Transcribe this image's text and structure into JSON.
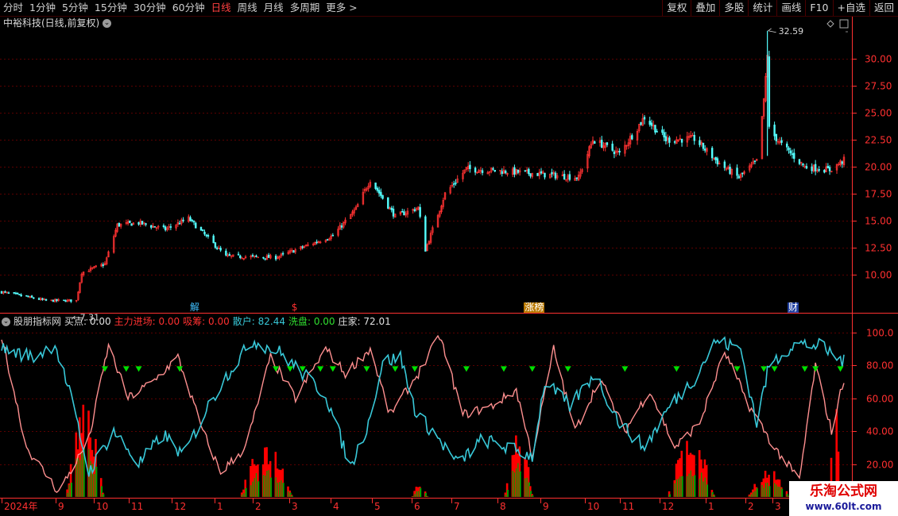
{
  "toolbar": {
    "periods": [
      "分时",
      "1分钟",
      "5分钟",
      "15分钟",
      "30分钟",
      "60分钟",
      "日线",
      "周线",
      "月线",
      "多周期",
      "更多 >"
    ],
    "active_period": "日线",
    "tools": [
      "复权",
      "叠加",
      "多股",
      "统计",
      "画线",
      "F10",
      "+自选",
      "返回"
    ]
  },
  "stock": {
    "title": "中裕科技(日线,前复权)"
  },
  "events": [
    {
      "label": "解",
      "color": "#40c0ff",
      "date": "2024-11-28"
    },
    {
      "label": "$",
      "color": "#ff3030",
      "date": "2025-01-24"
    },
    {
      "label": "涨榜",
      "color": "#ffffff",
      "bg": "#b87800",
      "date": "2025-06-04"
    },
    {
      "label": "财",
      "color": "#ffffff",
      "bg": "#2040a0",
      "date": "2025-10-30"
    }
  ],
  "indicator": {
    "name": "股朋指标网",
    "items": [
      {
        "label": "买点: 0.00",
        "color": "#e0e0e0"
      },
      {
        "label": "主力进场: 0.00",
        "color": "#ff3030"
      },
      {
        "label": "吸筹: 0.00",
        "color": "#ff3030"
      },
      {
        "label": "散户: 82.44",
        "color": "#38c8d8"
      },
      {
        "label": "洗盘: 0.00",
        "color": "#30e030"
      },
      {
        "label": "庄家: 72.01",
        "color": "#e0e0e0"
      }
    ]
  },
  "price_axis_labels": [
    "30.00",
    "27.50",
    "25.00",
    "22.50",
    "20.00",
    "17.50",
    "15.00",
    "12.50",
    "10.00"
  ],
  "indicator_axis_labels": [
    "100.0",
    "80.00",
    "60.00",
    "40.00",
    "20.00"
  ],
  "date_axis_labels": [
    "2024年",
    "9",
    "10",
    "11",
    "12",
    "1",
    "2",
    "3",
    "4",
    "5",
    "6",
    "7",
    "8",
    "9",
    "10",
    "11",
    "12",
    "1",
    "2",
    "3"
  ],
  "watermark": {
    "line1": "乐淘公式网",
    "line2": "www.60lt.com"
  },
  "colors": {
    "up": "#ff3232",
    "down": "#54ffff",
    "grid": "#5a0000",
    "axis": "#ff3030",
    "sanhu": "#38c8d8",
    "zhuangjia": "#ff9090",
    "buy_marker": "#00e000",
    "bars_red": "#ff0000",
    "bars_green": "#00a000"
  },
  "chart_data": {
    "type": "candlestick",
    "date_range": [
      "2024-08-12",
      "2025-11-28"
    ],
    "price_ylim": [
      7.31,
      32.59
    ],
    "price_ticks": [
      10,
      12.5,
      15,
      17.5,
      20,
      22.5,
      25,
      27.5,
      30
    ],
    "max_label": "32.59",
    "min_label": "7.31",
    "price_anchors": [
      {
        "date": "2024-08-12",
        "value": 8.4
      },
      {
        "date": "2024-09-06",
        "value": 7.6
      },
      {
        "date": "2024-09-23",
        "value": 7.6
      },
      {
        "date": "2024-09-26",
        "value": 10.2
      },
      {
        "date": "2024-10-09",
        "value": 11.0
      },
      {
        "date": "2024-10-16",
        "value": 14.6
      },
      {
        "date": "2024-10-28",
        "value": 14.8
      },
      {
        "date": "2024-11-12",
        "value": 14.2
      },
      {
        "date": "2024-11-25",
        "value": 15.2
      },
      {
        "date": "2024-12-16",
        "value": 11.7
      },
      {
        "date": "2025-01-13",
        "value": 11.6
      },
      {
        "date": "2025-02-14",
        "value": 13.6
      },
      {
        "date": "2025-02-27",
        "value": 16.1
      },
      {
        "date": "2025-03-07",
        "value": 18.8
      },
      {
        "date": "2025-03-21",
        "value": 15.4
      },
      {
        "date": "2025-04-03",
        "value": 16.2
      },
      {
        "date": "2025-04-07",
        "value": 12.3
      },
      {
        "date": "2025-04-18",
        "value": 17.5
      },
      {
        "date": "2025-04-30",
        "value": 19.8
      },
      {
        "date": "2025-05-20",
        "value": 19.6
      },
      {
        "date": "2025-06-05",
        "value": 19.4
      },
      {
        "date": "2025-06-18",
        "value": 19.2
      },
      {
        "date": "2025-07-02",
        "value": 19.0
      },
      {
        "date": "2025-07-10",
        "value": 22.5
      },
      {
        "date": "2025-07-25",
        "value": 21.2
      },
      {
        "date": "2025-08-08",
        "value": 24.6
      },
      {
        "date": "2025-08-20",
        "value": 22.5
      },
      {
        "date": "2025-09-05",
        "value": 22.6
      },
      {
        "date": "2025-09-19",
        "value": 20.3
      },
      {
        "date": "2025-09-30",
        "value": 19.0
      },
      {
        "date": "2025-10-10",
        "value": 20.5
      },
      {
        "date": "2025-10-14",
        "value": 26.0
      },
      {
        "date": "2025-10-16",
        "value": 30.5
      },
      {
        "date": "2025-10-17",
        "value": 23.5
      },
      {
        "date": "2025-10-23",
        "value": 22.2
      },
      {
        "date": "2025-11-06",
        "value": 20.0
      },
      {
        "date": "2025-11-20",
        "value": 19.7
      },
      {
        "date": "2025-11-28",
        "value": 20.6
      }
    ],
    "indicator_ylim": [
      0,
      110
    ],
    "indicator_ticks": [
      20,
      40,
      60,
      80,
      100
    ],
    "sanhu_anchors": [
      {
        "date": "2024-08-12",
        "value": 90
      },
      {
        "date": "2024-08-30",
        "value": 85
      },
      {
        "date": "2024-09-11",
        "value": 93
      },
      {
        "date": "2024-09-20",
        "value": 60
      },
      {
        "date": "2024-09-30",
        "value": 15
      },
      {
        "date": "2024-10-14",
        "value": 40
      },
      {
        "date": "2024-10-28",
        "value": 20
      },
      {
        "date": "2024-11-11",
        "value": 38
      },
      {
        "date": "2024-11-22",
        "value": 25
      },
      {
        "date": "2024-12-06",
        "value": 55
      },
      {
        "date": "2024-12-17",
        "value": 75
      },
      {
        "date": "2024-12-31",
        "value": 95
      },
      {
        "date": "2025-01-15",
        "value": 88
      },
      {
        "date": "2025-02-10",
        "value": 62
      },
      {
        "date": "2025-02-24",
        "value": 18
      },
      {
        "date": "2025-03-06",
        "value": 45
      },
      {
        "date": "2025-03-14",
        "value": 82
      },
      {
        "date": "2025-03-24",
        "value": 85
      },
      {
        "date": "2025-04-02",
        "value": 50
      },
      {
        "date": "2025-04-11",
        "value": 40
      },
      {
        "date": "2025-04-25",
        "value": 20
      },
      {
        "date": "2025-05-09",
        "value": 35
      },
      {
        "date": "2025-05-23",
        "value": 30
      },
      {
        "date": "2025-06-06",
        "value": 25
      },
      {
        "date": "2025-06-13",
        "value": 70
      },
      {
        "date": "2025-06-27",
        "value": 55
      },
      {
        "date": "2025-07-11",
        "value": 75
      },
      {
        "date": "2025-07-25",
        "value": 45
      },
      {
        "date": "2025-08-08",
        "value": 30
      },
      {
        "date": "2025-08-22",
        "value": 55
      },
      {
        "date": "2025-09-05",
        "value": 72
      },
      {
        "date": "2025-09-17",
        "value": 95
      },
      {
        "date": "2025-10-01",
        "value": 90
      },
      {
        "date": "2025-10-10",
        "value": 45
      },
      {
        "date": "2025-10-17",
        "value": 80
      },
      {
        "date": "2025-10-31",
        "value": 93
      },
      {
        "date": "2025-11-14",
        "value": 92
      },
      {
        "date": "2025-11-28",
        "value": 82
      }
    ],
    "zhuangjia_anchors": [
      {
        "date": "2024-08-12",
        "value": 98
      },
      {
        "date": "2024-08-26",
        "value": 30
      },
      {
        "date": "2024-09-13",
        "value": 3
      },
      {
        "date": "2024-09-30",
        "value": 35
      },
      {
        "date": "2024-10-11",
        "value": 92
      },
      {
        "date": "2024-10-22",
        "value": 60
      },
      {
        "date": "2024-11-05",
        "value": 70
      },
      {
        "date": "2024-11-19",
        "value": 85
      },
      {
        "date": "2024-12-03",
        "value": 40
      },
      {
        "date": "2024-12-13",
        "value": 15
      },
      {
        "date": "2024-12-27",
        "value": 30
      },
      {
        "date": "2025-01-10",
        "value": 85
      },
      {
        "date": "2025-01-24",
        "value": 60
      },
      {
        "date": "2025-02-10",
        "value": 90
      },
      {
        "date": "2025-02-21",
        "value": 75
      },
      {
        "date": "2025-03-07",
        "value": 90
      },
      {
        "date": "2025-03-18",
        "value": 50
      },
      {
        "date": "2025-04-03",
        "value": 75
      },
      {
        "date": "2025-04-15",
        "value": 98
      },
      {
        "date": "2025-04-28",
        "value": 50
      },
      {
        "date": "2025-05-14",
        "value": 55
      },
      {
        "date": "2025-05-28",
        "value": 65
      },
      {
        "date": "2025-06-06",
        "value": 25
      },
      {
        "date": "2025-06-18",
        "value": 90
      },
      {
        "date": "2025-06-30",
        "value": 40
      },
      {
        "date": "2025-07-14",
        "value": 72
      },
      {
        "date": "2025-07-28",
        "value": 40
      },
      {
        "date": "2025-08-11",
        "value": 65
      },
      {
        "date": "2025-08-25",
        "value": 30
      },
      {
        "date": "2025-09-08",
        "value": 45
      },
      {
        "date": "2025-09-22",
        "value": 88
      },
      {
        "date": "2025-10-06",
        "value": 55
      },
      {
        "date": "2025-10-20",
        "value": 30
      },
      {
        "date": "2025-11-03",
        "value": 10
      },
      {
        "date": "2025-11-12",
        "value": 80
      },
      {
        "date": "2025-11-21",
        "value": 40
      },
      {
        "date": "2025-11-28",
        "value": 72
      }
    ],
    "buy_markers": [
      "2024-10-09",
      "2024-10-21",
      "2024-10-28",
      "2024-11-20",
      "2025-01-13",
      "2025-01-21",
      "2025-01-28",
      "2025-02-07",
      "2025-02-14",
      "2025-03-05",
      "2025-03-21",
      "2025-04-01",
      "2025-04-30",
      "2025-05-21",
      "2025-06-06",
      "2025-06-26",
      "2025-07-28",
      "2025-08-26",
      "2025-09-29",
      "2025-10-14",
      "2025-10-20",
      "2025-11-06",
      "2025-11-12",
      "2025-11-26"
    ],
    "bar_clusters": [
      {
        "start": "2024-09-18",
        "end": "2024-10-08",
        "red_peak": 58,
        "green_peak": 32
      },
      {
        "start": "2024-12-25",
        "end": "2025-01-22",
        "red_peak": 35,
        "green_peak": 18
      },
      {
        "start": "2025-03-31",
        "end": "2025-04-08",
        "red_peak": 10,
        "green_peak": 6
      },
      {
        "start": "2025-05-22",
        "end": "2025-06-06",
        "red_peak": 45,
        "green_peak": 22
      },
      {
        "start": "2025-08-22",
        "end": "2025-09-16",
        "red_peak": 38,
        "green_peak": 20
      },
      {
        "start": "2025-10-06",
        "end": "2025-10-28",
        "red_peak": 18,
        "green_peak": 10
      },
      {
        "start": "2025-11-20",
        "end": "2025-11-26",
        "red_peak": 62,
        "green_peak": 0
      }
    ]
  }
}
